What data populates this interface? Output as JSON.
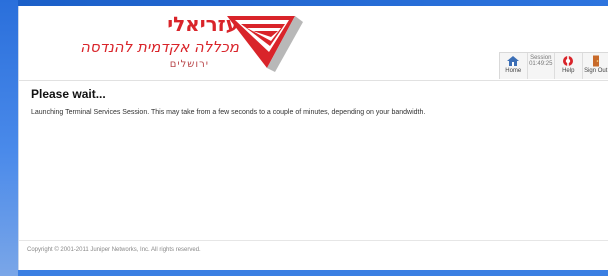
{
  "logo": {
    "line1": "עזריאלי",
    "line2": "מכללה אקדמית להנדסה",
    "line3": "ירושלים"
  },
  "toolbar": {
    "home_label": "Home",
    "session_label": "Session",
    "session_time": "01:49:25",
    "help_label": "Help",
    "signout_label": "Sign Out"
  },
  "main": {
    "title": "Please wait...",
    "message": "Launching Terminal Services Session. This may take from a few seconds to a couple of minutes, depending on your bandwidth."
  },
  "footer": {
    "copyright": "Copyright © 2001-2011 Juniper Networks, Inc. All rights reserved."
  },
  "colors": {
    "brand_red": "#d9242a",
    "desktop_blue": "#2c73dc"
  }
}
